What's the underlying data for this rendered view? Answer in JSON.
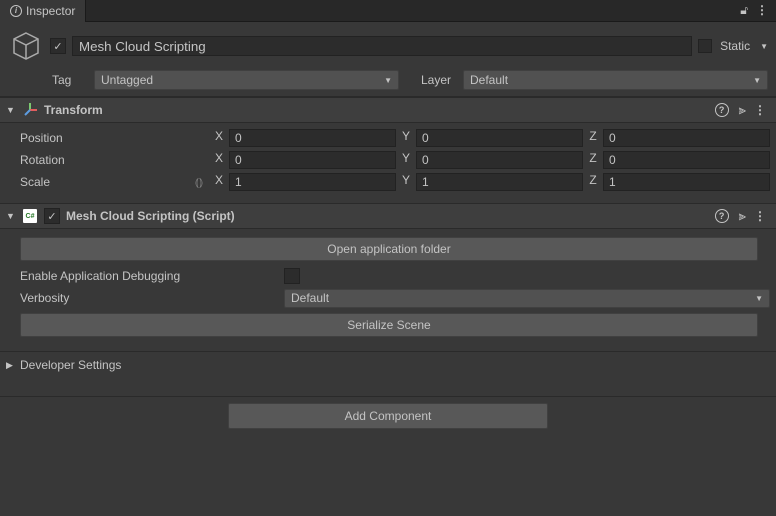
{
  "tab": {
    "title": "Inspector"
  },
  "header": {
    "name": "Mesh Cloud Scripting",
    "active": true,
    "static_label": "Static",
    "static": false,
    "tag_label": "Tag",
    "tag_value": "Untagged",
    "layer_label": "Layer",
    "layer_value": "Default"
  },
  "transform": {
    "title": "Transform",
    "position_label": "Position",
    "rotation_label": "Rotation",
    "scale_label": "Scale",
    "x_label": "X",
    "y_label": "Y",
    "z_label": "Z",
    "position": {
      "x": "0",
      "y": "0",
      "z": "0"
    },
    "rotation": {
      "x": "0",
      "y": "0",
      "z": "0"
    },
    "scale": {
      "x": "1",
      "y": "1",
      "z": "1"
    }
  },
  "script": {
    "title": "Mesh Cloud Scripting (Script)",
    "enabled": true,
    "open_folder_btn": "Open application folder",
    "enable_debug_label": "Enable Application Debugging",
    "enable_debug": false,
    "verbosity_label": "Verbosity",
    "verbosity_value": "Default",
    "serialize_btn": "Serialize Scene"
  },
  "developer": {
    "title": "Developer Settings"
  },
  "footer": {
    "add_component": "Add Component"
  }
}
